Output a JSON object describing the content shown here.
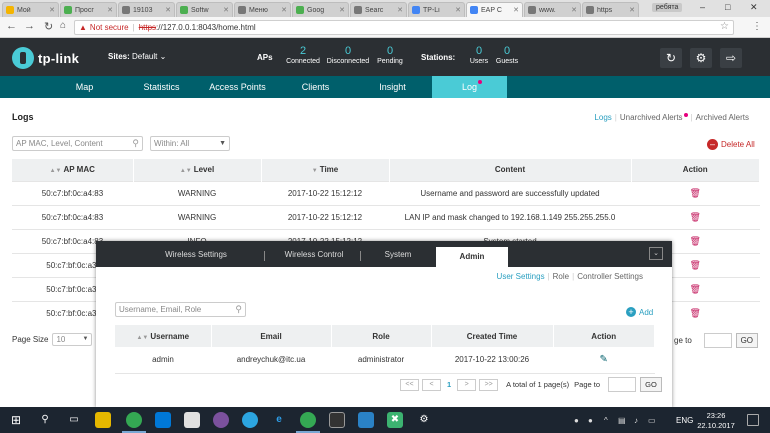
{
  "browser": {
    "tabs": [
      {
        "label": "Мой",
        "color": "#f4b400"
      },
      {
        "label": "Просг",
        "color": "#4caf50"
      },
      {
        "label": "19103",
        "color": "#777"
      },
      {
        "label": "Softw",
        "color": "#4caf50"
      },
      {
        "label": "Меню",
        "color": "#777"
      },
      {
        "label": "Goog",
        "color": "#4caf50"
      },
      {
        "label": "Searc",
        "color": "#777"
      },
      {
        "label": "TP-Li",
        "color": "#4285f4"
      },
      {
        "label": "EAP C",
        "color": "#4285f4"
      },
      {
        "label": "www.",
        "color": "#777"
      },
      {
        "label": "https",
        "color": "#777"
      }
    ],
    "profile": "ребята",
    "omnibox": {
      "warning": "Not secure",
      "scheme": "https",
      "rest": "://127.0.0.1:8043/home.html"
    }
  },
  "header": {
    "brand": "tp-link",
    "sites_label": "Sites:",
    "sites_value": "Default",
    "aps_label": "APs",
    "aps_stats": [
      {
        "num": "2",
        "label": "Connected"
      },
      {
        "num": "0",
        "label": "Disconnected"
      },
      {
        "num": "0",
        "label": "Pending"
      }
    ],
    "stations_label": "Stations:",
    "station_stats": [
      {
        "num": "0",
        "label": "Users"
      },
      {
        "num": "0",
        "label": "Guests"
      }
    ]
  },
  "nav": [
    "Map",
    "Statistics",
    "Access Points",
    "Clients",
    "Insight",
    "Log"
  ],
  "logs": {
    "title": "Logs",
    "links": [
      "Logs",
      "Unarchived Alerts",
      "Archived Alerts"
    ],
    "search_placeholder": "AP MAC, Level, Content",
    "within": "Within: All",
    "delete_all": "Delete All",
    "columns": [
      "AP MAC",
      "Level",
      "Time",
      "Content",
      "Action"
    ],
    "rows": [
      {
        "mac": "50:c7:bf:0c:a4:83",
        "level": "WARNING",
        "time": "2017-10-22 15:12:12",
        "content": "Username and password are successfully updated"
      },
      {
        "mac": "50:c7:bf:0c:a4:83",
        "level": "WARNING",
        "time": "2017-10-22 15:12:12",
        "content": "LAN IP and mask changed to 192.168.1.149 255.255.255.0"
      },
      {
        "mac": "50:c7:bf:0c:a4:83",
        "level": "INFO",
        "time": "2017-10-22 15:12:12",
        "content": "System started"
      },
      {
        "mac": "50:c7:bf:0c:a3:",
        "level": "",
        "time": "",
        "content": ""
      },
      {
        "mac": "50:c7:bf:0c:a3:",
        "level": "",
        "time": "",
        "content": ""
      },
      {
        "mac": "50:c7:bf:0c:a3:",
        "level": "",
        "time": "",
        "content": ""
      }
    ],
    "page_size_label": "Page Size",
    "page_size": "10",
    "page_to": "ge to",
    "go": "GO"
  },
  "modal": {
    "tabs": [
      "Wireless Settings",
      "Wireless Control",
      "System",
      "Admin"
    ],
    "subnav": [
      "User Settings",
      "Role",
      "Controller Settings"
    ],
    "search_placeholder": "Username, Email, Role",
    "add": "Add",
    "columns": [
      "Username",
      "Email",
      "Role",
      "Created Time",
      "Action"
    ],
    "rows": [
      {
        "username": "admin",
        "email": "andreychuk@itc.ua",
        "role": "administrator",
        "created": "2017-10-22 13:00:26"
      }
    ],
    "pager": {
      "first": "<<",
      "prev": "<",
      "page": "1",
      "next": ">",
      "last": ">>",
      "summary": "A total of 1 page(s)",
      "page_to": "Page to",
      "go": "GO"
    }
  },
  "taskbar": {
    "lang": "ENG",
    "time": "23:26",
    "date": "22.10.2017"
  }
}
